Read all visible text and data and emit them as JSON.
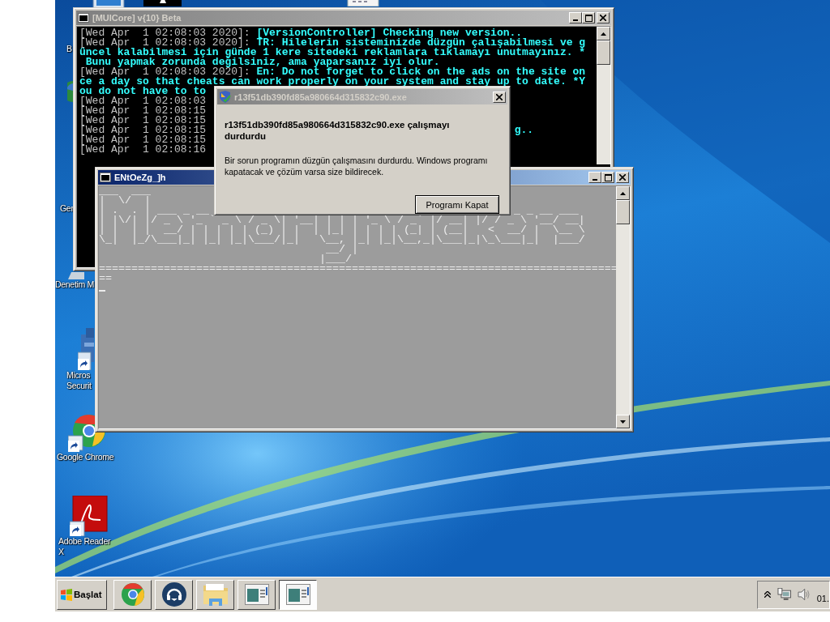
{
  "desktop": {
    "icons": [
      {
        "kind": "monitor"
      },
      {
        "kind": "terminal"
      },
      {
        "kind": "document"
      },
      {
        "kind": "none",
        "label": [
          "B"
        ]
      },
      {
        "kind": "globe"
      },
      {
        "kind": "none",
        "label": [
          "Ger"
        ]
      },
      {
        "kind": "control-panel",
        "label": [
          "Denetim M"
        ]
      },
      {
        "kind": "security",
        "shortcut": true,
        "label": [
          "Micros",
          "Securit"
        ]
      },
      {
        "kind": "chrome",
        "shortcut": true,
        "label": [
          "Google Chrome"
        ]
      },
      {
        "kind": "adobe",
        "shortcut": true,
        "label": [
          "Adobe Reader",
          "X"
        ]
      }
    ]
  },
  "console": {
    "title": "[MUICore] v{10} Beta",
    "active": false,
    "lines": [
      {
        "stamp": "[Wed Apr  1 02:08:03 2020]:",
        "text": "[VersionController] Checking new version.."
      },
      {
        "stamp": "[Wed Apr  1 02:08:03 2020]:",
        "text": "TR: Hilelerin sisteminizde düzgün çalışabilmesi ve g"
      },
      {
        "text": "üncel kalabilmesi için günde 1 kere sitedeki reklamlara tıklamayı unutmayınız. *"
      },
      {
        "text": " Bunu yapmak zorunda değilsiniz, ama yaparsanız iyi olur."
      },
      {
        "stamp": "[Wed Apr  1 02:08:03 2020]:",
        "text": "En: Do not forget to click on the ads on the site on"
      },
      {
        "text": "ce a day so that cheats can work properly on your system and stay up to date. *Y"
      },
      {
        "text": "ou do not have to to"
      },
      {
        "stamp": "[Wed Apr  1 02:08:03"
      },
      {
        "stamp": "[Wed Apr  1 02:08:15"
      },
      {
        "stamp": "[Wed Apr  1 02:08:15"
      },
      {
        "stamp": "[Wed Apr  1 02:08:15",
        "tail": "g.."
      },
      {
        "stamp": "[Wed Apr  1 02:08:15"
      },
      {
        "stamp": "[Wed Apr  1 02:08:16"
      }
    ]
  },
  "app_window": {
    "title": "ENtOeZg_]h",
    "active": true,
    "lines": [
      {
        "text": "___  ___"
      },
      {
        "text": "|  \\/  |"
      },
      {
        "text": "| .  . | ___ _ __",
        "right": "_ _ __ ___"
      },
      {
        "text": "| |\\/| |/ _ \\ '_ ` _ \\ / _ \\| '__| | | | '_ \\ / _` |/ __| |/ / _ \\ '__/ __|"
      },
      {
        "text": "| |  | |  __/ | | | | | (_) | |  | |_| | | | | (_| | (__|   <  __/ |  \\__ \\"
      },
      {
        "text": "\\_|  |_/\\___|_| |_| |_|\\___/|_|   \\__, |_| |_|\\__,_|\\___|_|\\_\\___|_|  |___/"
      },
      {
        "text": "                                   __/ |"
      },
      {
        "text": "                                  |___/"
      },
      {
        "text": "================================================================================"
      },
      {
        "text": "=="
      }
    ]
  },
  "dialog": {
    "title": "r13f51db390fd85a980664d315832c90.exe",
    "active": false,
    "heading": "r13f51db390fd85a980664d315832c90.exe çalışmayı durdurdu",
    "message": "Bir sorun programın düzgün çalışmasını durdurdu. Windows programı kapatacak ve çözüm varsa size bildirecek.",
    "button": "Programı Kapat"
  },
  "taskbar": {
    "start": "Başlat",
    "tasks": [
      {
        "kind": "chrome",
        "selected": false
      },
      {
        "kind": "headset",
        "selected": false
      },
      {
        "kind": "folder",
        "selected": false
      },
      {
        "kind": "console",
        "selected": false
      },
      {
        "kind": "console",
        "selected": true
      }
    ],
    "clock": "01."
  }
}
